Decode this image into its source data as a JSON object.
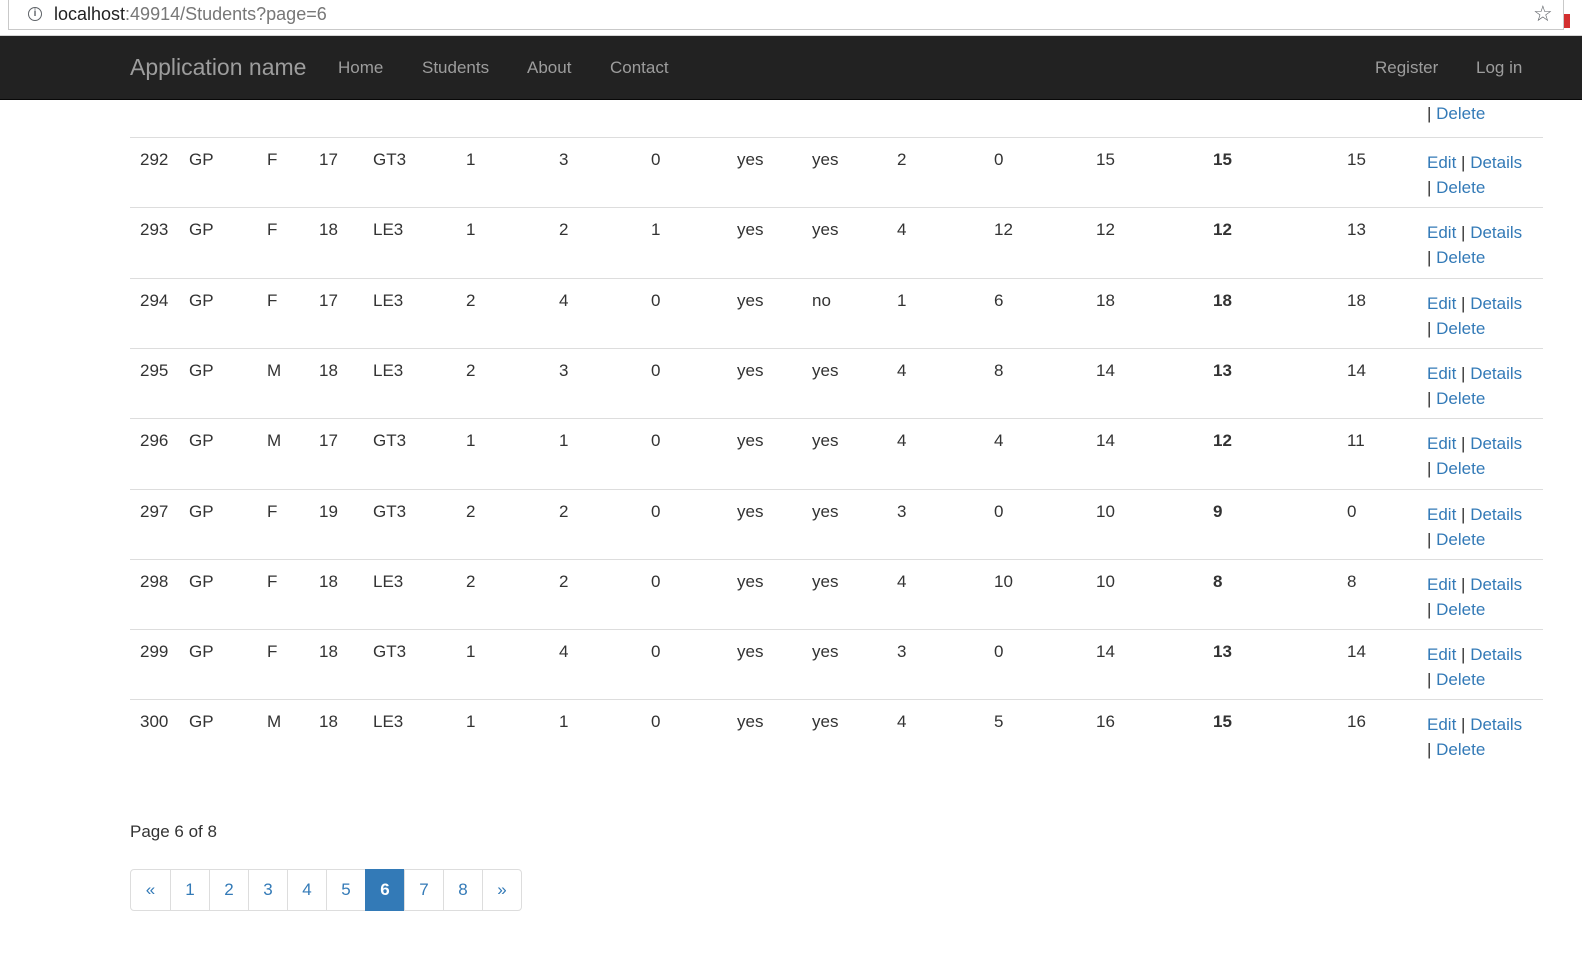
{
  "browser": {
    "url_host": "localhost",
    "url_rest": ":49914/Students?page=6"
  },
  "navbar": {
    "brand": "Application name",
    "links": [
      "Home",
      "Students",
      "About",
      "Contact"
    ],
    "right_links": [
      "Register",
      "Log in"
    ]
  },
  "actions": {
    "edit": "Edit",
    "details": "Details",
    "delete": "Delete",
    "separator": "|"
  },
  "table": {
    "rows": [
      [
        "292",
        "GP",
        "F",
        "17",
        "GT3",
        "1",
        "3",
        "0",
        "yes",
        "yes",
        "2",
        "0",
        "15",
        "15",
        "15"
      ],
      [
        "293",
        "GP",
        "F",
        "18",
        "LE3",
        "1",
        "2",
        "1",
        "yes",
        "yes",
        "4",
        "12",
        "12",
        "12",
        "13"
      ],
      [
        "294",
        "GP",
        "F",
        "17",
        "LE3",
        "2",
        "4",
        "0",
        "yes",
        "no",
        "1",
        "6",
        "18",
        "18",
        "18"
      ],
      [
        "295",
        "GP",
        "M",
        "18",
        "LE3",
        "2",
        "3",
        "0",
        "yes",
        "yes",
        "4",
        "8",
        "14",
        "13",
        "14"
      ],
      [
        "296",
        "GP",
        "M",
        "17",
        "GT3",
        "1",
        "1",
        "0",
        "yes",
        "yes",
        "4",
        "4",
        "14",
        "12",
        "11"
      ],
      [
        "297",
        "GP",
        "F",
        "19",
        "GT3",
        "2",
        "2",
        "0",
        "yes",
        "yes",
        "3",
        "0",
        "10",
        "9",
        "0"
      ],
      [
        "298",
        "GP",
        "F",
        "18",
        "LE3",
        "2",
        "2",
        "0",
        "yes",
        "yes",
        "4",
        "10",
        "10",
        "8",
        "8"
      ],
      [
        "299",
        "GP",
        "F",
        "18",
        "GT3",
        "1",
        "4",
        "0",
        "yes",
        "yes",
        "3",
        "0",
        "14",
        "13",
        "14"
      ],
      [
        "300",
        "GP",
        "M",
        "18",
        "LE3",
        "1",
        "1",
        "0",
        "yes",
        "yes",
        "4",
        "5",
        "16",
        "15",
        "16"
      ]
    ]
  },
  "pagination": {
    "info": "Page 6 of 8",
    "pages": [
      "«",
      "1",
      "2",
      "3",
      "4",
      "5",
      "6",
      "7",
      "8",
      "»"
    ],
    "active": "6"
  },
  "colors": {
    "navbar_bg": "#222222",
    "link": "#337ab7",
    "active_page_bg": "#337ab7"
  }
}
